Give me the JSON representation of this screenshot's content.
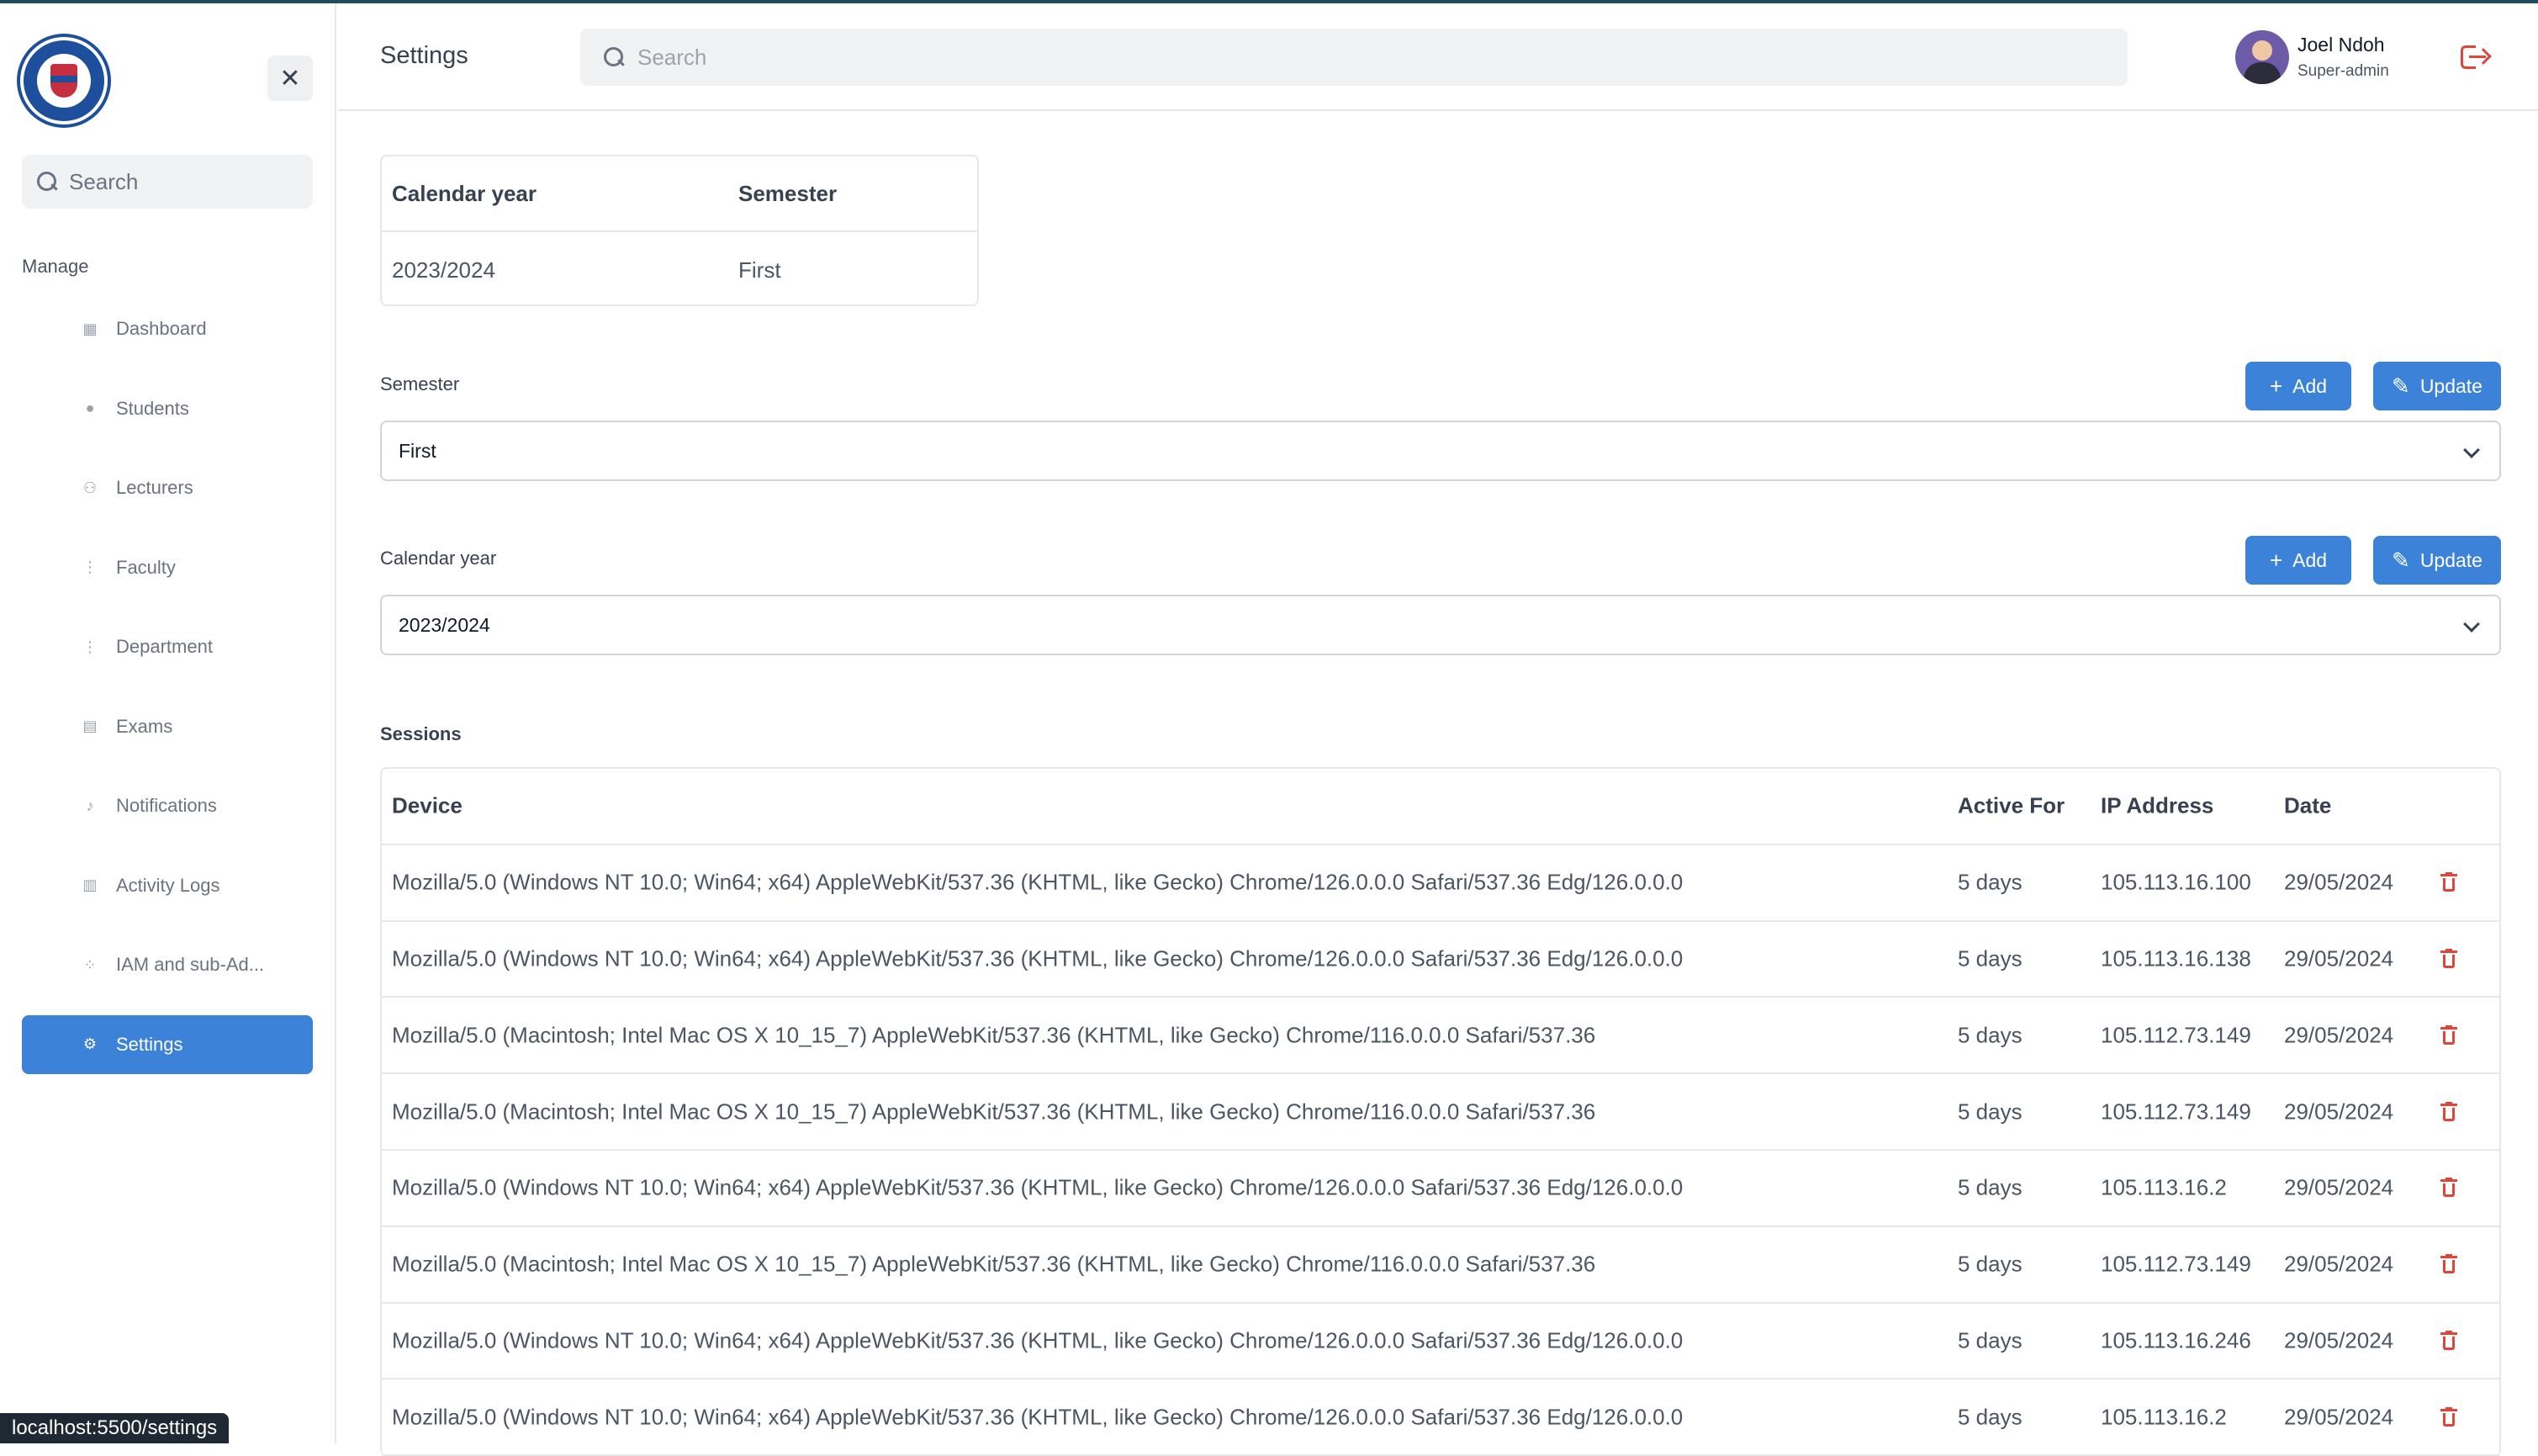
{
  "sidebar": {
    "search_placeholder": "Search",
    "section_label": "Manage",
    "items": [
      {
        "label": "Dashboard",
        "icon": "grid-icon"
      },
      {
        "label": "Students",
        "icon": "user-icon"
      },
      {
        "label": "Lecturers",
        "icon": "users-icon"
      },
      {
        "label": "Faculty",
        "icon": "hierarchy-icon"
      },
      {
        "label": "Department",
        "icon": "hierarchy-icon"
      },
      {
        "label": "Exams",
        "icon": "document-icon"
      },
      {
        "label": "Notifications",
        "icon": "bell-icon"
      },
      {
        "label": "Activity Logs",
        "icon": "bar-chart-icon"
      },
      {
        "label": "IAM and sub-Ad...",
        "icon": "nodes-icon"
      },
      {
        "label": "Settings",
        "icon": "gear-icon",
        "active": true
      }
    ],
    "accent_color": "#3b82d8"
  },
  "status_url": "localhost:5500/settings",
  "header": {
    "title": "Settings",
    "search_placeholder": "Search",
    "user": {
      "name": "Joel Ndoh",
      "role": "Super-admin"
    }
  },
  "current": {
    "headers": [
      "Calendar year",
      "Semester"
    ],
    "values": [
      "2023/2024",
      "First"
    ]
  },
  "semester": {
    "label": "Semester",
    "selected": "First",
    "add_label": "Add",
    "update_label": "Update"
  },
  "calendar": {
    "label": "Calendar year",
    "selected": "2023/2024",
    "add_label": "Add",
    "update_label": "Update"
  },
  "sessions": {
    "title": "Sessions",
    "columns": [
      "Device",
      "Active For",
      "IP Address",
      "Date"
    ],
    "rows": [
      {
        "device": "Mozilla/5.0 (Windows NT 10.0; Win64; x64) AppleWebKit/537.36 (KHTML, like Gecko) Chrome/126.0.0.0 Safari/537.36 Edg/126.0.0.0",
        "active": "5 days",
        "ip": "105.113.16.100",
        "date": "29/05/2024"
      },
      {
        "device": "Mozilla/5.0 (Windows NT 10.0; Win64; x64) AppleWebKit/537.36 (KHTML, like Gecko) Chrome/126.0.0.0 Safari/537.36 Edg/126.0.0.0",
        "active": "5 days",
        "ip": "105.113.16.138",
        "date": "29/05/2024"
      },
      {
        "device": "Mozilla/5.0 (Macintosh; Intel Mac OS X 10_15_7) AppleWebKit/537.36 (KHTML, like Gecko) Chrome/116.0.0.0 Safari/537.36",
        "active": "5 days",
        "ip": "105.112.73.149",
        "date": "29/05/2024"
      },
      {
        "device": "Mozilla/5.0 (Macintosh; Intel Mac OS X 10_15_7) AppleWebKit/537.36 (KHTML, like Gecko) Chrome/116.0.0.0 Safari/537.36",
        "active": "5 days",
        "ip": "105.112.73.149",
        "date": "29/05/2024"
      },
      {
        "device": "Mozilla/5.0 (Windows NT 10.0; Win64; x64) AppleWebKit/537.36 (KHTML, like Gecko) Chrome/126.0.0.0 Safari/537.36 Edg/126.0.0.0",
        "active": "5 days",
        "ip": "105.113.16.2",
        "date": "29/05/2024"
      },
      {
        "device": "Mozilla/5.0 (Macintosh; Intel Mac OS X 10_15_7) AppleWebKit/537.36 (KHTML, like Gecko) Chrome/116.0.0.0 Safari/537.36",
        "active": "5 days",
        "ip": "105.112.73.149",
        "date": "29/05/2024"
      },
      {
        "device": "Mozilla/5.0 (Windows NT 10.0; Win64; x64) AppleWebKit/537.36 (KHTML, like Gecko) Chrome/126.0.0.0 Safari/537.36 Edg/126.0.0.0",
        "active": "5 days",
        "ip": "105.113.16.246",
        "date": "29/05/2024"
      },
      {
        "device": "Mozilla/5.0 (Windows NT 10.0; Win64; x64) AppleWebKit/537.36 (KHTML, like Gecko) Chrome/126.0.0.0 Safari/537.36 Edg/126.0.0.0",
        "active": "5 days",
        "ip": "105.113.16.2",
        "date": "29/05/2024"
      }
    ]
  }
}
